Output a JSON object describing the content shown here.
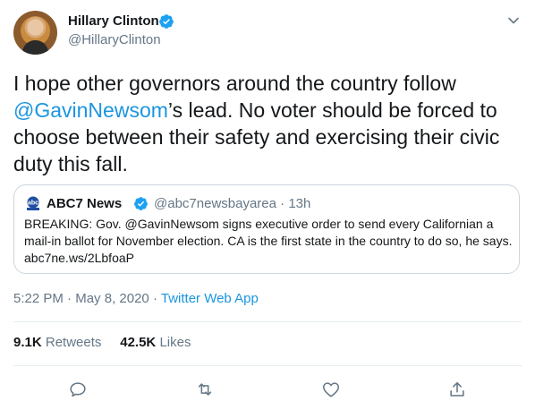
{
  "author": {
    "name": "Hillary Clinton",
    "handle": "@HillaryClinton"
  },
  "tweet": {
    "text_before": "I hope other governors around the country follow ",
    "mention": "@GavinNewsom",
    "text_after": "’s lead. No voter should be forced to choose between their safety and exercising their civic duty this fall."
  },
  "quoted": {
    "name": "ABC7 News",
    "handle": "@abc7newsbayarea",
    "separator": "·",
    "age": "13h",
    "text": "BREAKING: Gov. @GavinNewsom  signs executive order to send every Californian a mail-in ballot for November election. CA is the first state in the country to do so, he says. abc7ne.ws/2LbfoaP"
  },
  "meta": {
    "time": "5:22 PM",
    "date": "May 8, 2020",
    "separator": "·",
    "source": "Twitter Web App"
  },
  "stats": {
    "retweets_count": "9.1K",
    "retweets_label": "Retweets",
    "likes_count": "42.5K",
    "likes_label": "Likes"
  },
  "icons": {
    "verified": "verified-badge-icon",
    "caret": "chevron-down-icon",
    "reply": "reply-icon",
    "retweet": "retweet-icon",
    "like": "heart-icon",
    "share": "share-icon"
  },
  "colors": {
    "link": "#1b95e0",
    "secondary_text": "#657786",
    "verified": "#1da1f2"
  }
}
